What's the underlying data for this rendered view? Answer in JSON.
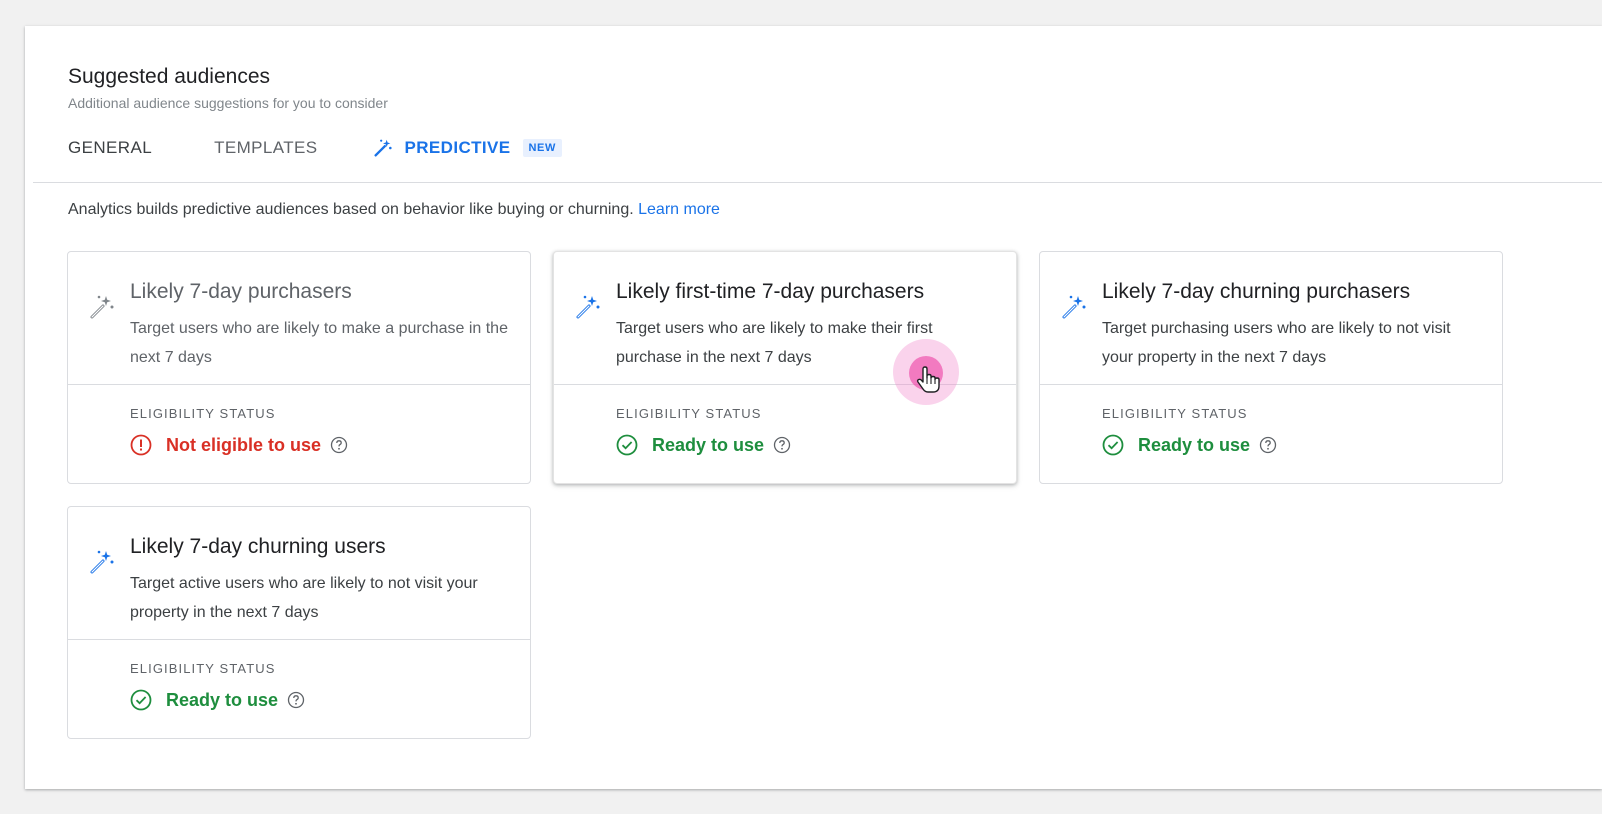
{
  "header": {
    "title": "Suggested audiences",
    "subtitle": "Additional audience suggestions for you to consider"
  },
  "tabs": [
    {
      "label": "GENERAL",
      "active": false
    },
    {
      "label": "TEMPLATES",
      "active": false
    },
    {
      "label": "PREDICTIVE",
      "active": true,
      "badge": "NEW",
      "icon": "magic-wand-icon"
    }
  ],
  "info": {
    "text": "Analytics builds predictive audiences based on behavior like buying or churning.",
    "link": "Learn more"
  },
  "eligibility_label": "ELIGIBILITY STATUS",
  "cards": [
    {
      "title": "Likely 7-day purchasers",
      "description": "Target users who are likely to make a purchase in the next 7 days",
      "status": "Not eligible to use",
      "status_type": "error",
      "icon": "magic-wand-icon"
    },
    {
      "title": "Likely first-time 7-day purchasers",
      "description": "Target users who are likely to make their first purchase in the next 7 days",
      "status": "Ready to use",
      "status_type": "ready",
      "icon": "magic-wand-icon"
    },
    {
      "title": "Likely 7-day churning purchasers",
      "description": "Target purchasing users who are likely to not visit your property in the next 7 days",
      "status": "Ready to use",
      "status_type": "ready",
      "icon": "magic-wand-icon"
    },
    {
      "title": "Likely 7-day churning users",
      "description": "Target active users who are likely to not visit your property in the next 7 days",
      "status": "Ready to use",
      "status_type": "ready",
      "icon": "magic-wand-icon"
    }
  ],
  "colors": {
    "accent": "#1a73e8",
    "ready": "#1e8e3e",
    "error": "#d93025",
    "border": "#dadce0"
  }
}
